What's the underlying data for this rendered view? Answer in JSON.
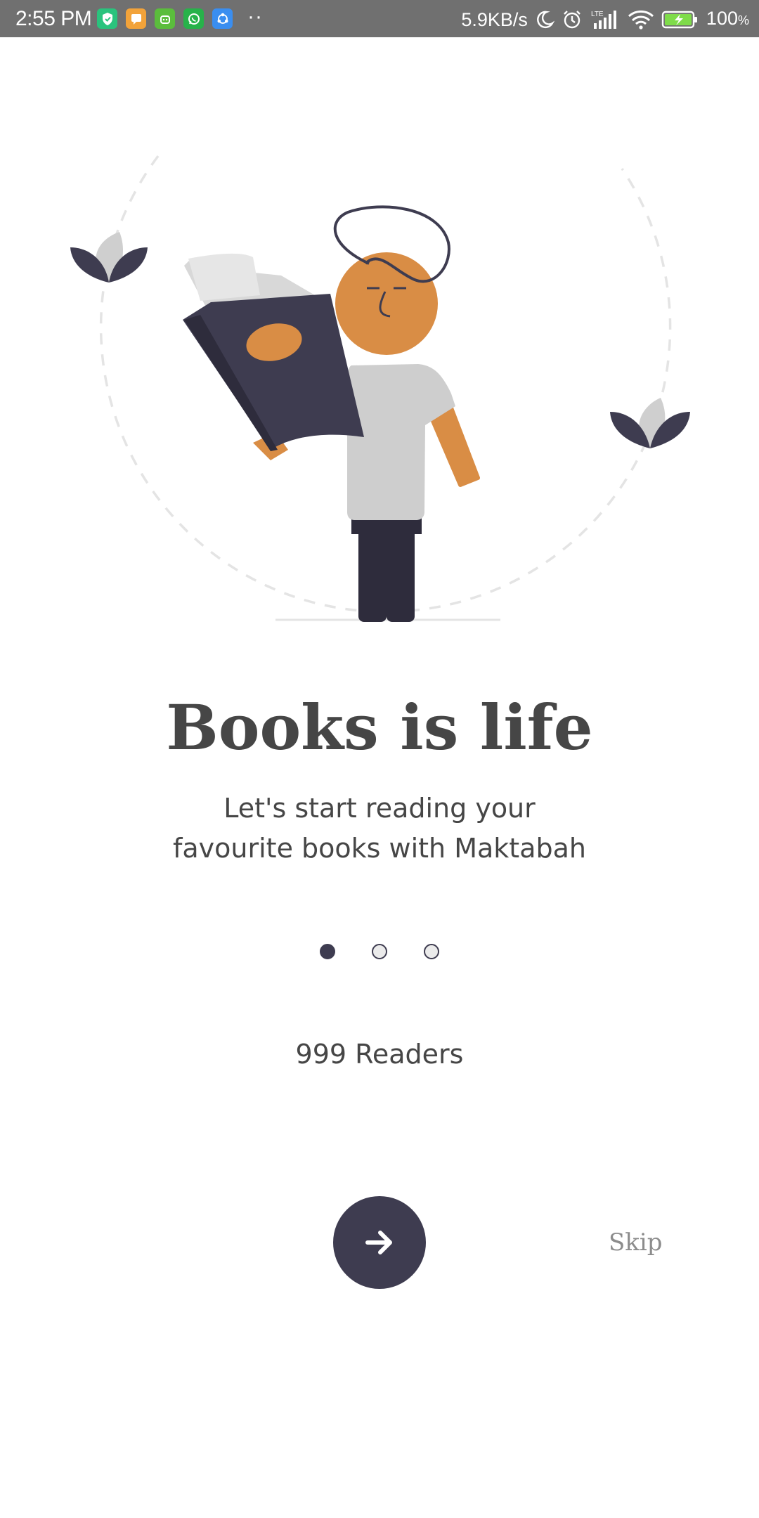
{
  "status_bar": {
    "time": "2:55 PM",
    "net_speed": "5.9KB/s",
    "network_type": "LTE",
    "battery": "100",
    "battery_unit": "%",
    "more_indicator": "··",
    "notification_icons": [
      "shield-app-icon",
      "message-app-icon",
      "android-app-icon",
      "whatsapp-icon",
      "share-app-icon"
    ]
  },
  "onboarding": {
    "title": "Books is life",
    "subtitle_line1": "Let's start reading your",
    "subtitle_line2": "favourite books with Maktabah",
    "readers": "999 Readers",
    "page_indicator": {
      "count": 3,
      "active_index": 0
    },
    "skip_label": "Skip",
    "next_icon": "arrow-right-icon"
  },
  "colors": {
    "primary_dark": "#3e3c50",
    "skin": "#d98d45",
    "shirt": "#cecece",
    "text": "#464646",
    "skip_text": "#8c8c8c",
    "status_bar": "#707070"
  }
}
